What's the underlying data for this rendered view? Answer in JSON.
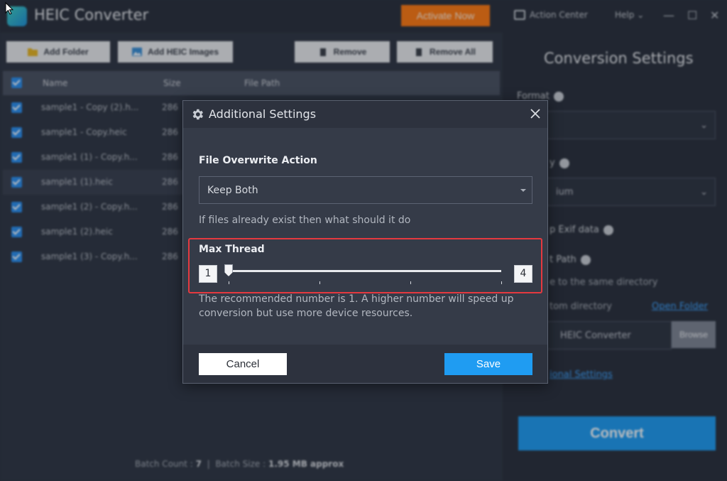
{
  "app": {
    "title": "HEIC Converter",
    "activate_label": "Activate Now",
    "action_center_label": "Action Center",
    "help_label": "Help",
    "window_controls": {
      "minimize": "—",
      "maximize": "☐",
      "close": "✕"
    }
  },
  "toolbar": {
    "add_folder_label": "Add Folder",
    "add_images_label": "Add HEIC Images",
    "remove_label": "Remove",
    "remove_all_label": "Remove All"
  },
  "file_table": {
    "columns": [
      "Name",
      "Size",
      "File Path"
    ],
    "rows": [
      {
        "name": "sample1 - Copy (2).h...",
        "size": "286"
      },
      {
        "name": "sample1 - Copy.heic",
        "size": "286"
      },
      {
        "name": "sample1 (1) - Copy.h...",
        "size": "286"
      },
      {
        "name": "sample1 (1).heic",
        "size": "286"
      },
      {
        "name": "sample1 (2) - Copy.h...",
        "size": "286"
      },
      {
        "name": "sample1 (2).heic",
        "size": "286"
      },
      {
        "name": "sample1 (3) - Copy.h...",
        "size": "286"
      }
    ]
  },
  "status_bar": {
    "batch_count_label": "Batch Count :",
    "batch_count_value": "7",
    "separator": "|",
    "batch_size_label": "Batch Size :",
    "batch_size_value": "1.95 MB approx"
  },
  "conversion_settings": {
    "title": "Conversion Settings",
    "format_label": "Format",
    "quality_label": "y",
    "quality_value": "ium",
    "exif_label": "p Exif data",
    "output_path_label": "t Path",
    "same_directory_label": "e to the same directory",
    "custom_directory_label": "tom directory",
    "open_folder_link": "Open Folder",
    "path_value": "HEIC Converter",
    "browse_label": "Browse",
    "additional_settings_link": "ional Settings",
    "convert_label": "Convert"
  },
  "dialog": {
    "title": "Additional Settings",
    "overwrite": {
      "label": "File Overwrite Action",
      "selected": "Keep Both",
      "hint": "If files already exist then what should it do"
    },
    "max_thread": {
      "label": "Max Thread",
      "min": "1",
      "max": "4",
      "value": 1,
      "hint": "The recommended number is 1. A higher number will speed up conversion but use more device resources."
    },
    "cancel_label": "Cancel",
    "save_label": "Save"
  },
  "colors": {
    "accent_blue": "#1f9cf2",
    "activate_orange": "#ff7a12",
    "highlight_red": "#e5393f",
    "dialog_bg": "#353b48"
  }
}
